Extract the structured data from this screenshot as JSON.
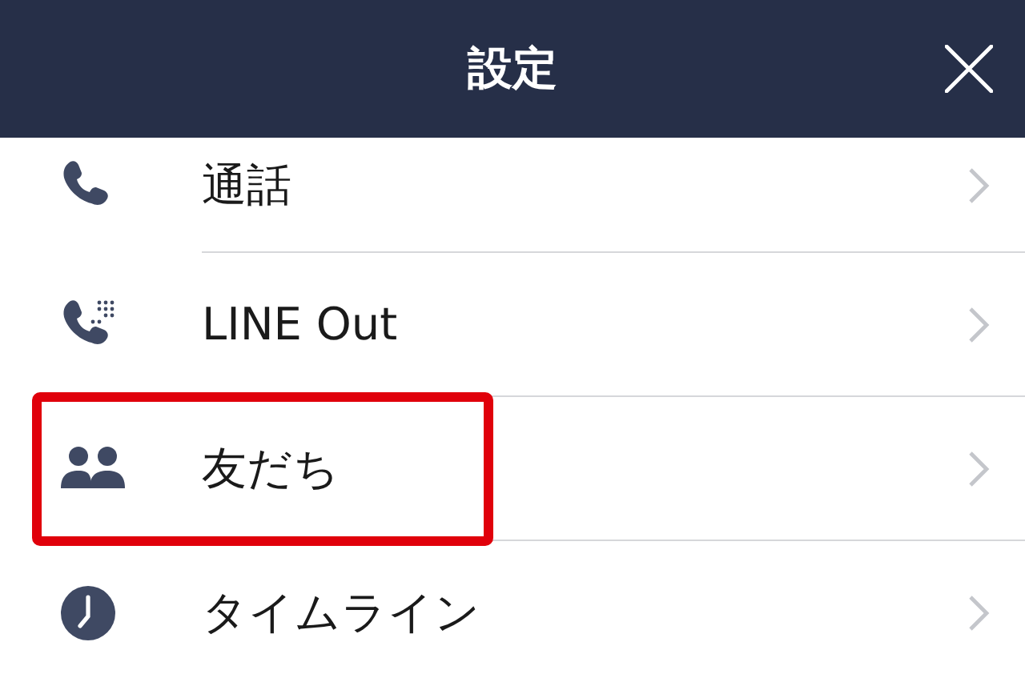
{
  "header": {
    "title": "設定"
  },
  "items": [
    {
      "kind": "phone",
      "label": "通話",
      "highlighted": false
    },
    {
      "kind": "phone-dots",
      "label": "LINE Out",
      "highlighted": false
    },
    {
      "kind": "friends",
      "label": "友だち",
      "highlighted": true
    },
    {
      "kind": "clock",
      "label": "タイムライン",
      "highlighted": false
    }
  ]
}
